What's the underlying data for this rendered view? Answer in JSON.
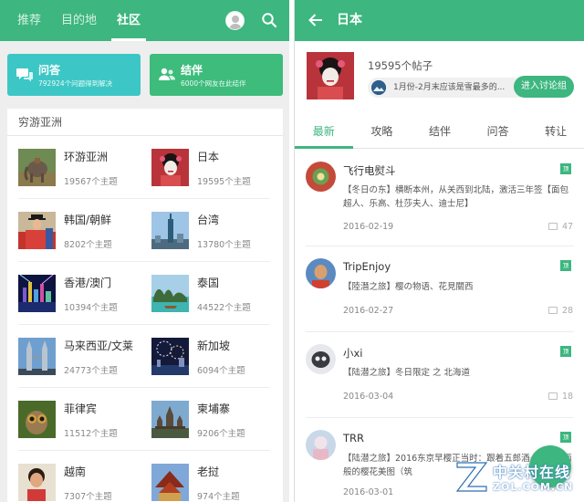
{
  "left": {
    "tabs": [
      {
        "label": "推荐",
        "active": false
      },
      {
        "label": "目的地",
        "active": false
      },
      {
        "label": "社区",
        "active": true
      }
    ],
    "icons": {
      "avatar": "user-avatar-icon",
      "search": "search-icon"
    },
    "cards": {
      "qa": {
        "title": "问答",
        "subtitle": "792924个问题得到解决",
        "icon": "chat-bubbles-icon",
        "color": "#3cc7c6"
      },
      "jieban": {
        "title": "结伴",
        "subtitle": "6000个网友在此结伴",
        "icon": "people-icon",
        "color": "#3dbc7c"
      }
    },
    "region_title": "穷游亚洲",
    "countries": [
      {
        "name": "环游亚洲",
        "count": "19567个主题",
        "image": "elephant-photo"
      },
      {
        "name": "日本",
        "count": "19595个主题",
        "image": "geisha-photo"
      },
      {
        "name": "韩国/朝鲜",
        "count": "8202个主题",
        "image": "korean-guard-photo"
      },
      {
        "name": "台湾",
        "count": "13780个主题",
        "image": "taipei-101-photo"
      },
      {
        "name": "香港/澳门",
        "count": "10394个主题",
        "image": "hong-kong-night-photo"
      },
      {
        "name": "泰国",
        "count": "44522个主题",
        "image": "thai-islands-photo"
      },
      {
        "name": "马来西亚/文莱",
        "count": "24773个主题",
        "image": "petronas-towers-photo"
      },
      {
        "name": "新加坡",
        "count": "6094个主题",
        "image": "singapore-fireworks-photo"
      },
      {
        "name": "菲律宾",
        "count": "11512个主题",
        "image": "tarsier-photo"
      },
      {
        "name": "柬埔寨",
        "count": "9206个主题",
        "image": "angkor-wat-photo"
      },
      {
        "name": "越南",
        "count": "7307个主题",
        "image": "vietnam-child-photo"
      },
      {
        "name": "老挝",
        "count": "974个主题",
        "image": "laos-temple-photo"
      }
    ]
  },
  "right": {
    "title": "日本",
    "icons": {
      "back": "back-arrow-icon"
    },
    "post_count": "19595个帖子",
    "hint": "1月份-2月末应该是雪最多的...",
    "join_label": "进入讨论组",
    "tabs": [
      {
        "label": "最新",
        "active": true
      },
      {
        "label": "攻略",
        "active": false
      },
      {
        "label": "结伴",
        "active": false
      },
      {
        "label": "问答",
        "active": false
      },
      {
        "label": "转让",
        "active": false
      }
    ],
    "posts": [
      {
        "author": "飞行电熨斗",
        "tag": "顶",
        "body": "【冬日の东】横断本州，从关西到北陆，激活三年签【面包超人、乐高、杜莎夫人、迪士尼】",
        "date": "2016-02-19",
        "comments": "47"
      },
      {
        "author": "TripEnjoy",
        "tag": "顶",
        "body": "【陸潛之旅】樱の物语、花見關西",
        "date": "2016-02-27",
        "comments": "28"
      },
      {
        "author": "小xi",
        "tag": "顶",
        "body": "【陆潜之旅】冬日限定 之 北海道",
        "date": "2016-03-04",
        "comments": "18"
      },
      {
        "author": "TRR",
        "tag": "顶",
        "body": "【陆潜之旅】2016东京早樱正当时：跟着五郎酒~电影画面般的樱花美图（筑",
        "date": "2016-03-01",
        "comments": ""
      }
    ]
  },
  "watermark": {
    "line1": "中关村在线",
    "line2": "ZOL.COM.CN"
  },
  "colors": {
    "brand_green": "#3db67f",
    "teal": "#3cc7c6"
  }
}
